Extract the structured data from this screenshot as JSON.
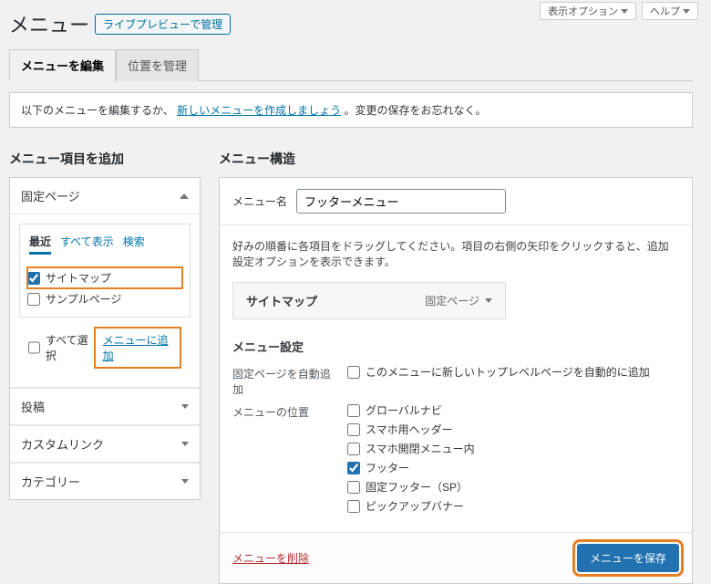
{
  "header": {
    "title": "メニュー",
    "live_preview_btn": "ライブプレビューで管理",
    "screen_options": "表示オプション",
    "help": "ヘルプ"
  },
  "tabs": {
    "edit": "メニューを編集",
    "locations": "位置を管理"
  },
  "manage_bar": {
    "prefix": "以下のメニューを編集するか、",
    "create_link": "新しいメニューを作成しましょう",
    "suffix": "。変更の保存をお忘れなく。"
  },
  "left": {
    "title": "メニュー項目を追加",
    "accordion": {
      "pages": "固定ページ",
      "posts": "投稿",
      "custom": "カスタムリンク",
      "categories": "カテゴリー"
    },
    "inner_tabs": {
      "recent": "最近",
      "all": "すべて表示",
      "search": "検索"
    },
    "items": [
      {
        "label": "サイトマップ",
        "checked": true
      },
      {
        "label": "サンプルページ",
        "checked": false
      }
    ],
    "select_all": "すべて選択",
    "add_to_menu": "メニューに追加"
  },
  "right": {
    "title": "メニュー構造",
    "name_label": "メニュー名",
    "name_value": "フッターメニュー",
    "hint": "好みの順番に各項目をドラッグしてください。項目の右側の矢印をクリックすると、追加設定オプションを表示できます。",
    "menu_items": [
      {
        "title": "サイトマップ",
        "type": "固定ページ"
      }
    ],
    "settings": {
      "title": "メニュー設定",
      "auto_add_label": "固定ページを自動追加",
      "auto_add_opt": "このメニューに新しいトップレベルページを自動的に追加",
      "location_label": "メニューの位置",
      "locations": [
        {
          "label": "グローバルナビ",
          "checked": false
        },
        {
          "label": "スマホ用ヘッダー",
          "checked": false
        },
        {
          "label": "スマホ開閉メニュー内",
          "checked": false
        },
        {
          "label": "フッター",
          "checked": true
        },
        {
          "label": "固定フッター（SP）",
          "checked": false
        },
        {
          "label": "ピックアップバナー",
          "checked": false
        }
      ]
    },
    "delete": "メニューを削除",
    "save": "メニューを保存"
  }
}
